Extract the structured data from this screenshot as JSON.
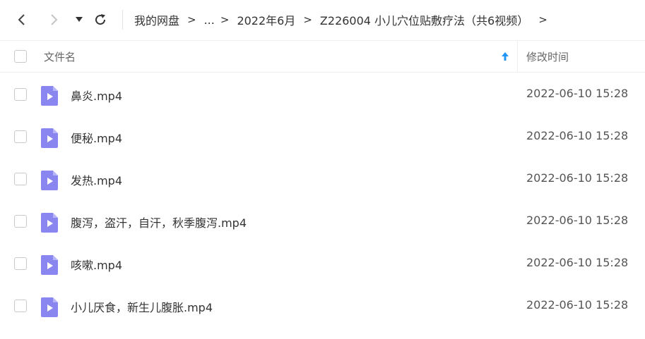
{
  "nav": {
    "back_icon": "chevron-left-icon",
    "forward_icon": "chevron-right-icon",
    "history_icon": "caret-down-icon",
    "refresh_icon": "refresh-icon"
  },
  "breadcrumb": {
    "items": [
      "我的网盘",
      "...",
      "2022年6月",
      "Z226004 小儿穴位贴敷疗法（共6视频）"
    ],
    "separator": ">"
  },
  "table": {
    "header": {
      "name_label": "文件名",
      "time_label": "修改时间",
      "sort_icon": "arrow-up-icon",
      "sort_color": "#2196f3"
    },
    "rows": [
      {
        "name": "鼻炎.mp4",
        "time": "2022-06-10 15:28"
      },
      {
        "name": "便秘.mp4",
        "time": "2022-06-10 15:28"
      },
      {
        "name": "发热.mp4",
        "time": "2022-06-10 15:28"
      },
      {
        "name": "腹泻，盗汗，自汗，秋季腹泻.mp4",
        "time": "2022-06-10 15:28"
      },
      {
        "name": "咳嗽.mp4",
        "time": "2022-06-10 15:28"
      },
      {
        "name": "小儿厌食，新生儿腹胀.mp4",
        "time": "2022-06-10 15:28"
      }
    ],
    "file_icon": "video-file-icon",
    "file_icon_color": "#8a86ef"
  }
}
